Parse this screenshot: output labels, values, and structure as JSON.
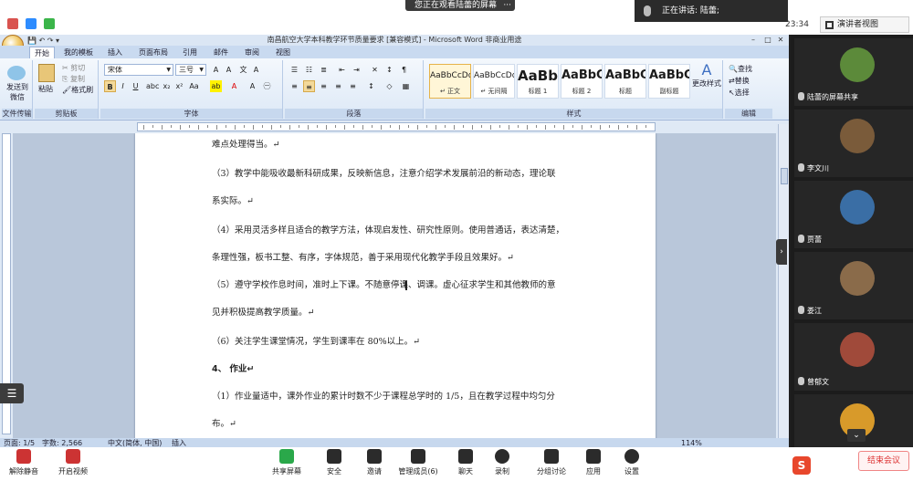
{
  "zoom_top": {
    "share_banner": "您正在观看陆蕾的屏幕",
    "share_more": "···",
    "speaking": "正在讲话: 陆蕾;",
    "time": "23:34",
    "presenter_view": "演讲者视图"
  },
  "word": {
    "title": "南昌航空大学本科教学环节质量要求 [兼容模式] - Microsoft Word 非商业用途",
    "tabs": [
      "开始",
      "我的模板",
      "插入",
      "页面布局",
      "引用",
      "邮件",
      "审阅",
      "视图"
    ],
    "groups": {
      "wechat": {
        "label": "文件传输",
        "button": "发送到微信"
      },
      "clipboard": {
        "label": "剪贴板",
        "paste": "粘贴",
        "cut": "剪切",
        "copy": "复制",
        "format_painter": "格式刷"
      },
      "font": {
        "label": "字体",
        "font_name": "宋体",
        "font_size": "三号"
      },
      "paragraph": {
        "label": "段落"
      },
      "styles": {
        "label": "样式",
        "items": [
          {
            "sample": "AaBbCcDd",
            "name": "↵ 正文"
          },
          {
            "sample": "AaBbCcDd",
            "name": "↵ 无间隔"
          },
          {
            "sample": "AaBb",
            "name": "标题 1"
          },
          {
            "sample": "AaBbC",
            "name": "标题 2"
          },
          {
            "sample": "AaBbC",
            "name": "标题"
          },
          {
            "sample": "AaBbC",
            "name": "副标题"
          }
        ],
        "change_styles": "更改样式"
      },
      "editing": {
        "label": "编辑",
        "find": "查找",
        "replace": "替换",
        "select": "选择"
      }
    },
    "document": {
      "paragraphs": [
        "难点处理得当。↵",
        "（3）教学中能吸收最新科研成果，反映新信息，注意介绍学术发展前沿的新动态，理论联",
        "系实际。↵",
        "（4）采用灵活多样且适合的教学方法，体现启发性、研究性原则。使用普通话，表达清楚，",
        "条理性强，板书工整、有序，字体规范，善于采用现代化教学手段且效果好。↵",
        "（5）遵守学校作息时间，准时上下课。不随意停课、调课。虚心征求学生和其他教师的意",
        "见并积极提高教学质量。↵",
        "（6）关注学生课堂情况，学生到课率在 80%以上。↵",
        "4、 作业↵",
        "（1）作业量适中，课外作业的累计时数不少于课程总学时的 1/5，且在教学过程中均匀分",
        "布。↵"
      ]
    },
    "status": {
      "page": "页面: 1/5",
      "words": "字数: 2,566",
      "language": "中文(简体, 中国)",
      "insert": "插入",
      "zoom": "114%"
    }
  },
  "participants": [
    {
      "name": "陆蕾的屏幕共享",
      "avatar_color": "#5c8a3a"
    },
    {
      "name": "李文川",
      "avatar_color": "#7a5b3a"
    },
    {
      "name": "贾蕾",
      "avatar_color": "#3a6ea5"
    },
    {
      "name": "娄江",
      "avatar_color": "#8a6b4a"
    },
    {
      "name": "曾郁文",
      "avatar_color": "#a04a3a"
    },
    {
      "name": "",
      "avatar_color": "#d89a2a"
    }
  ],
  "zoom_bottom": {
    "items": [
      "解除静音",
      "开启视频",
      "共享屏幕",
      "安全",
      "邀请",
      "管理成员(6)",
      "聊天",
      "录制",
      "分组讨论",
      "应用",
      "设置"
    ],
    "brand_tip": "结束会议"
  }
}
